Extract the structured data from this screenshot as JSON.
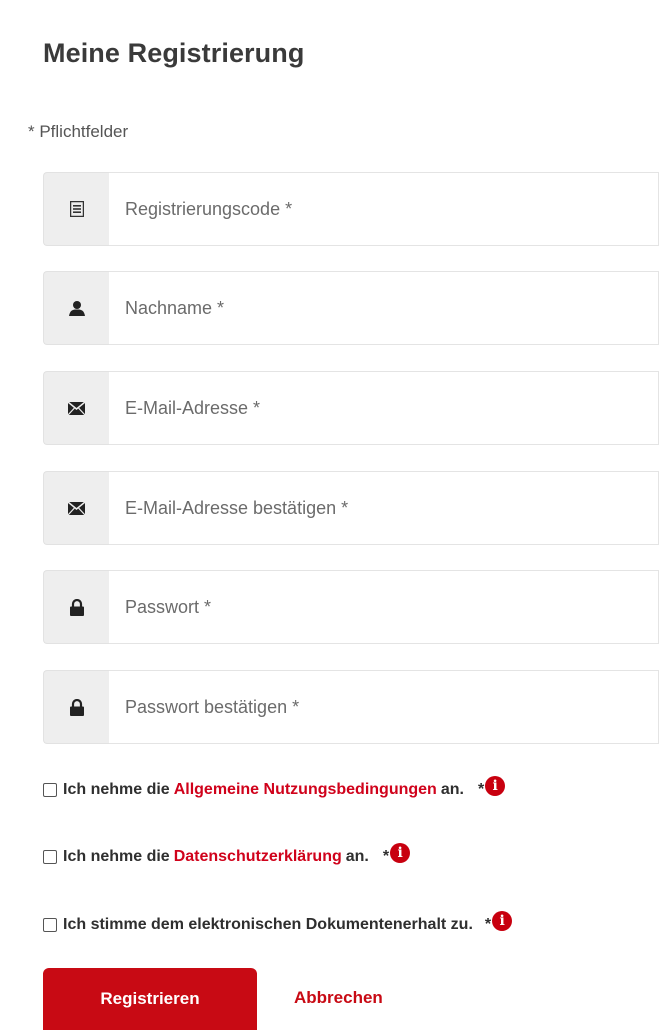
{
  "title": "Meine Registrierung",
  "required_note": "* Pflichtfelder",
  "fields": [
    {
      "icon": "list-icon",
      "placeholder": "Registrierungscode *"
    },
    {
      "icon": "user-icon",
      "placeholder": "Nachname *"
    },
    {
      "icon": "envelope-icon",
      "placeholder": "E-Mail-Adresse *"
    },
    {
      "icon": "envelope-icon",
      "placeholder": "E-Mail-Adresse bestätigen *"
    },
    {
      "icon": "lock-icon",
      "placeholder": "Passwort *"
    },
    {
      "icon": "lock-icon",
      "placeholder": "Passwort bestätigen *"
    }
  ],
  "consents": [
    {
      "prefix": "Ich nehme die",
      "link": "Allgemeine Nutzungsbedingungen",
      "suffix": "an.",
      "required": "*",
      "checked": false
    },
    {
      "prefix": "Ich nehme die",
      "link": "Datenschutzerklärung",
      "suffix": "an.",
      "required": "*",
      "checked": false
    },
    {
      "prefix": "Ich stimme dem elektronischen Dokumentenerhalt zu.",
      "link": "",
      "suffix": "",
      "required": "*",
      "checked": false
    }
  ],
  "buttons": {
    "submit_label": "Registrieren",
    "cancel_label": "Abbrechen"
  },
  "colors": {
    "accent": "#c80a14",
    "link": "#d0021b",
    "addon_background": "#eeeeee"
  }
}
